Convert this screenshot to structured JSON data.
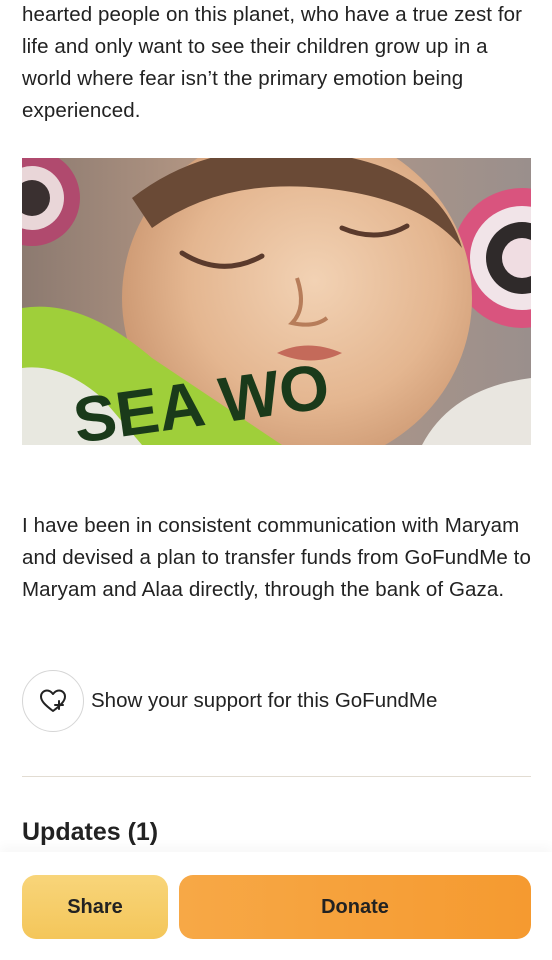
{
  "story": {
    "paragraph_1": "hearted people on this planet, who have a true zest for life and only want to see their children grow up in a world where fear isn’t the primary emotion being experienced.",
    "paragraph_2": "I have been in consistent communication with Maryam and devised a plan to transfer funds from GoFundMe to Maryam and Alaa directly, through the bank of Gaza.",
    "photo_visible_text": "SEA WO"
  },
  "support": {
    "icon": "heart-plus-icon",
    "label": "Show your support for this GoFundMe"
  },
  "updates": {
    "heading": "Updates (1)"
  },
  "actions": {
    "share_label": "Share",
    "donate_label": "Donate"
  },
  "colors": {
    "share_button": "#f6cc66",
    "donate_button": "#f6a03a",
    "divider": "#e2dcd2",
    "text": "#222222"
  }
}
